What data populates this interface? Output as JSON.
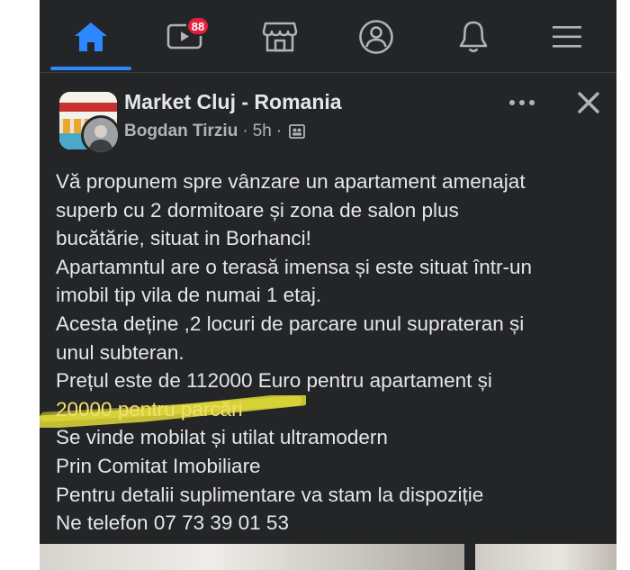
{
  "nav": {
    "items": [
      {
        "name": "home",
        "icon": "home-icon",
        "active": true
      },
      {
        "name": "watch",
        "icon": "video-icon",
        "badge": "88"
      },
      {
        "name": "marketplace",
        "icon": "marketplace-icon"
      },
      {
        "name": "profile",
        "icon": "profile-icon"
      },
      {
        "name": "notifications",
        "icon": "bell-icon"
      },
      {
        "name": "menu",
        "icon": "menu-icon"
      }
    ],
    "accent_color": "#2d88ff",
    "badge_color": "#e41e3f"
  },
  "post": {
    "group_name": "Market Cluj - Romania",
    "author": "Bogdan Tirziu",
    "time": "5h",
    "separator": "·",
    "privacy_icon": "group-audience-icon",
    "lines": [
      "Vă propunem spre vânzare un apartament amenajat",
      "superb cu 2 dormitoare și zona de salon plus",
      "bucătărie, situat in Borhanci!",
      "Apartamntul are o terasă imensa și este situat într-un",
      "imobil tip vila de numai 1 etaj.",
      "Acesta deține ,2 locuri de parcare unul suprateran și",
      "unul subteran.",
      "Prețul este de 112000 Euro pentru apartament și",
      "20000 pentru parcări",
      "Se vinde mobilat și utilat ultramodern",
      "Prin Comitat Imobiliare",
      "Pentru detalii suplimentare va stam la dispoziție",
      "Ne telefon 07 73 39 01 53"
    ],
    "highlighted_line_index": 8,
    "highlight_color": "#e8e23a"
  },
  "theme": {
    "background": "#242526",
    "text": "#e4e6eb",
    "secondary_text": "#b0b3b8"
  }
}
